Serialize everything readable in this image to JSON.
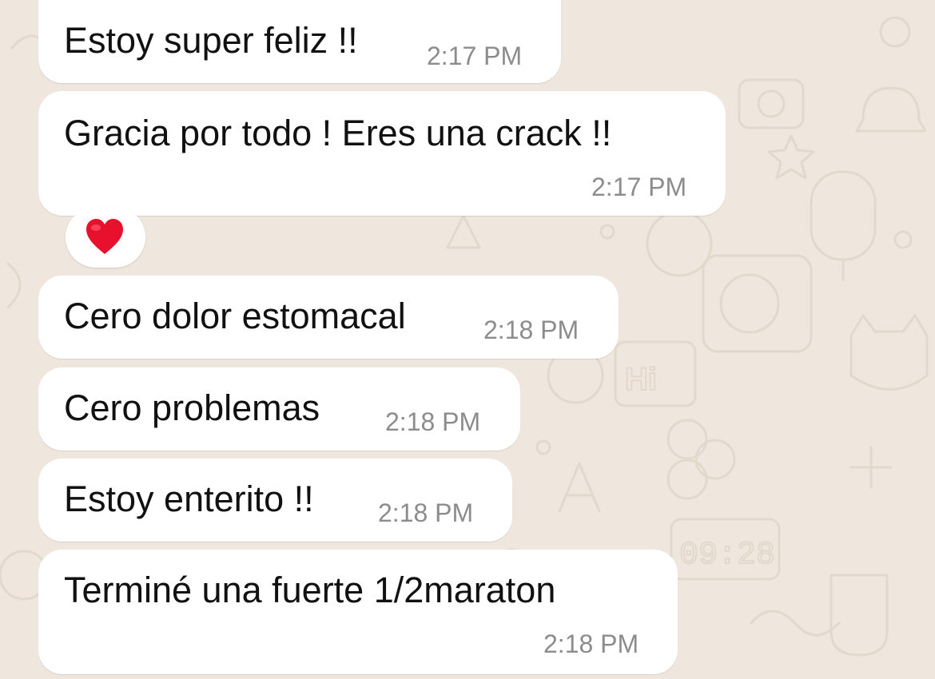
{
  "colors": {
    "wallpaper": "#efe7dd",
    "bubble": "#ffffff",
    "text": "#111111",
    "timestamp": "#8c8c8c",
    "reaction_heart": "#e8112d"
  },
  "messages": [
    {
      "text": "Estoy super feliz !!",
      "time": "2:17 PM"
    },
    {
      "text": "Gracia por todo ! Eres una crack !!",
      "time": "2:17 PM",
      "reaction": "heart-icon"
    },
    {
      "text": "Cero dolor estomacal",
      "time": "2:18 PM"
    },
    {
      "text": "Cero problemas",
      "time": "2:18 PM"
    },
    {
      "text": "Estoy enterito !!",
      "time": "2:18 PM"
    },
    {
      "text": "Terminé una fuerte 1/2maraton",
      "time": "2:18 PM"
    }
  ]
}
